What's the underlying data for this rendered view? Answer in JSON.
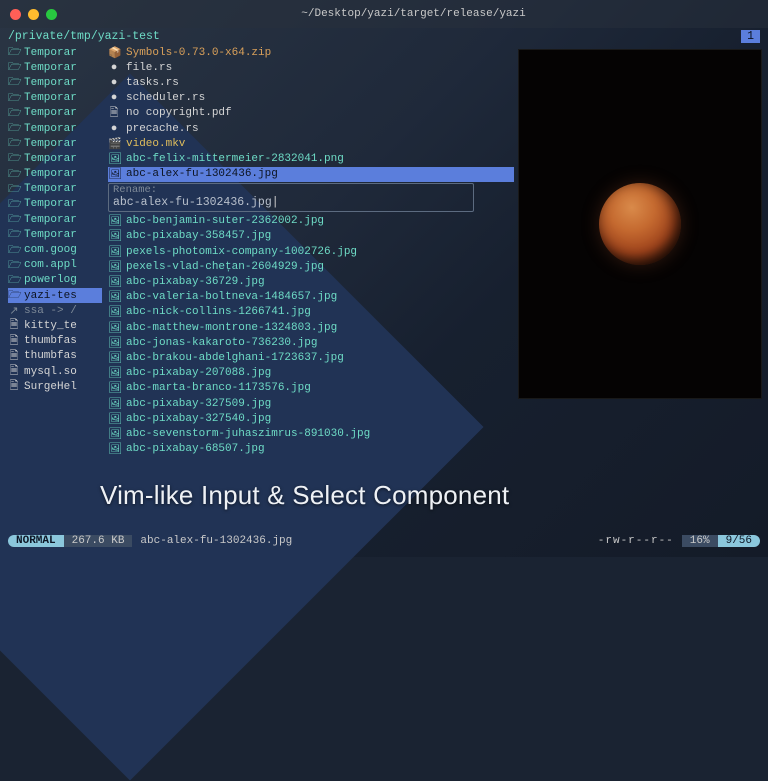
{
  "window": {
    "title": "~/Desktop/yazi/target/release/yazi"
  },
  "path": "/private/tmp/yazi-test",
  "tab_indicator": "1",
  "sidebar": {
    "items": [
      {
        "label": "Temporar",
        "type": "folder"
      },
      {
        "label": "Temporar",
        "type": "folder"
      },
      {
        "label": "Temporar",
        "type": "folder"
      },
      {
        "label": "Temporar",
        "type": "folder"
      },
      {
        "label": "Temporar",
        "type": "folder"
      },
      {
        "label": "Temporar",
        "type": "folder"
      },
      {
        "label": "Temporar",
        "type": "folder"
      },
      {
        "label": "Temporar",
        "type": "folder"
      },
      {
        "label": "Temporar",
        "type": "folder"
      },
      {
        "label": "Temporar",
        "type": "folder"
      },
      {
        "label": "Temporar",
        "type": "folder"
      },
      {
        "label": "Temporar",
        "type": "folder"
      },
      {
        "label": "Temporar",
        "type": "folder"
      },
      {
        "label": "com.goog",
        "type": "folder"
      },
      {
        "label": "com.appl",
        "type": "folder"
      },
      {
        "label": "powerlog",
        "type": "folder"
      },
      {
        "label": "yazi-tes",
        "type": "folder",
        "selected": true
      },
      {
        "label": "ssa -> /",
        "type": "link",
        "dim": true
      },
      {
        "label": "kitty_te",
        "type": "file",
        "white": true
      },
      {
        "label": "thumbfas",
        "type": "file",
        "white": true
      },
      {
        "label": "thumbfas",
        "type": "file",
        "white": true
      },
      {
        "label": "mysql.so",
        "type": "file",
        "white": true
      },
      {
        "label": "SurgeHel",
        "type": "file",
        "white": true
      }
    ]
  },
  "files": {
    "before_rename": [
      {
        "icon": "📦",
        "name": "Symbols-0.73.0-x64.zip",
        "color": "orange"
      },
      {
        "icon": "●",
        "name": "file.rs",
        "color": "white"
      },
      {
        "icon": "●",
        "name": "tasks.rs",
        "color": "white"
      },
      {
        "icon": "●",
        "name": "scheduler.rs",
        "color": "white"
      },
      {
        "icon": "🗎",
        "name": "no copyright.pdf",
        "color": "white"
      },
      {
        "icon": "●",
        "name": "precache.rs",
        "color": "white"
      },
      {
        "icon": "🎬",
        "name": "video.mkv",
        "color": "yellow"
      },
      {
        "icon": "🖼",
        "name": "abc-felix-mittermeier-2832041.png",
        "color": "teal"
      }
    ],
    "highlighted": {
      "icon": "🖼",
      "name": "abc-alex-fu-1302436.jpg"
    },
    "rename": {
      "label": "Rename:",
      "value": "abc-alex-fu-1302436.jpg"
    },
    "after_rename": [
      {
        "icon": "🖼",
        "name": "abc-benjamin-suter-2362002.jpg"
      },
      {
        "icon": "🖼",
        "name": "abc-pixabay-358457.jpg"
      },
      {
        "icon": "🖼",
        "name": "pexels-photomix-company-1002726.jpg"
      },
      {
        "icon": "🖼",
        "name": "pexels-vlad-chețan-2604929.jpg"
      },
      {
        "icon": "🖼",
        "name": "abc-pixabay-36729.jpg"
      },
      {
        "icon": "🖼",
        "name": "abc-valeria-boltneva-1484657.jpg"
      },
      {
        "icon": "🖼",
        "name": "abc-nick-collins-1266741.jpg"
      },
      {
        "icon": "🖼",
        "name": "abc-matthew-montrone-1324803.jpg"
      },
      {
        "icon": "🖼",
        "name": "abc-jonas-kakaroto-736230.jpg"
      },
      {
        "icon": "🖼",
        "name": "abc-brakou-abdelghani-1723637.jpg"
      },
      {
        "icon": "🖼",
        "name": "abc-pixabay-207088.jpg"
      },
      {
        "icon": "🖼",
        "name": "abc-marta-branco-1173576.jpg"
      },
      {
        "icon": "🖼",
        "name": "abc-pixabay-327509.jpg"
      },
      {
        "icon": "🖼",
        "name": "abc-pixabay-327540.jpg"
      },
      {
        "icon": "🖼",
        "name": "abc-sevenstorm-juhaszimrus-891030.jpg"
      },
      {
        "icon": "🖼",
        "name": "abc-pixabay-68507.jpg"
      }
    ]
  },
  "caption": "Vim-like Input & Select Component",
  "status": {
    "mode": "NORMAL",
    "size": "267.6 KB",
    "filename": "abc-alex-fu-1302436.jpg",
    "permissions": "-rw-r--r--",
    "percent": "16%",
    "position": "9/56"
  }
}
